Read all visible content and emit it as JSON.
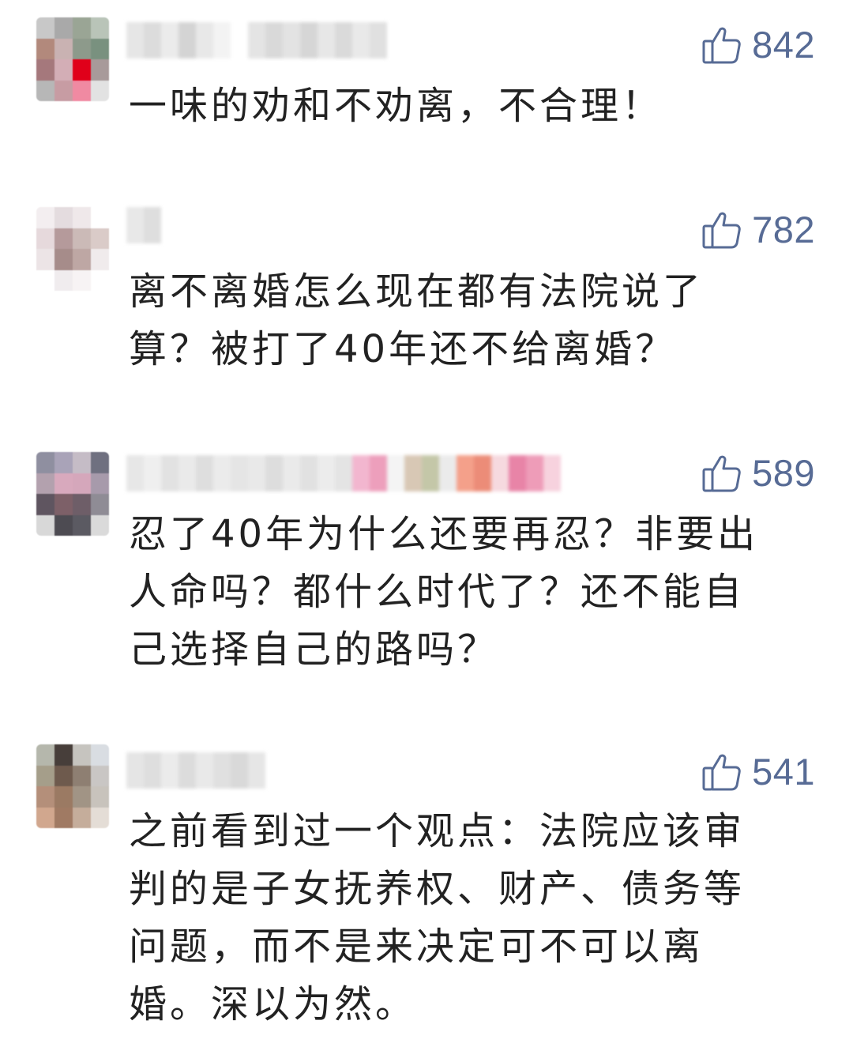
{
  "comments": [
    {
      "likes": "842",
      "text": "一味的劝和不劝离，不合理！"
    },
    {
      "likes": "782",
      "text": "离不离婚怎么现在都有法院说了\n算？被打了40年还不给离婚？"
    },
    {
      "likes": "589",
      "text": "忍了40年为什么还要再忍？非要出\n人命吗？都什么时代了？还不能自\n己选择自己的路吗？"
    },
    {
      "likes": "541",
      "text": "之前看到过一个观点：法院应该审\n判的是子女抚养权、财产、债务等\n问题，而不是来决定可不可以离\n婚。深以为然。"
    }
  ],
  "colors": {
    "like_accent": "#576b95",
    "text": "#222222",
    "background": "#ffffff"
  },
  "icons": {
    "like": "thumbs-up-icon",
    "avatar": "pixelated-avatar",
    "username": "pixelated-username"
  }
}
